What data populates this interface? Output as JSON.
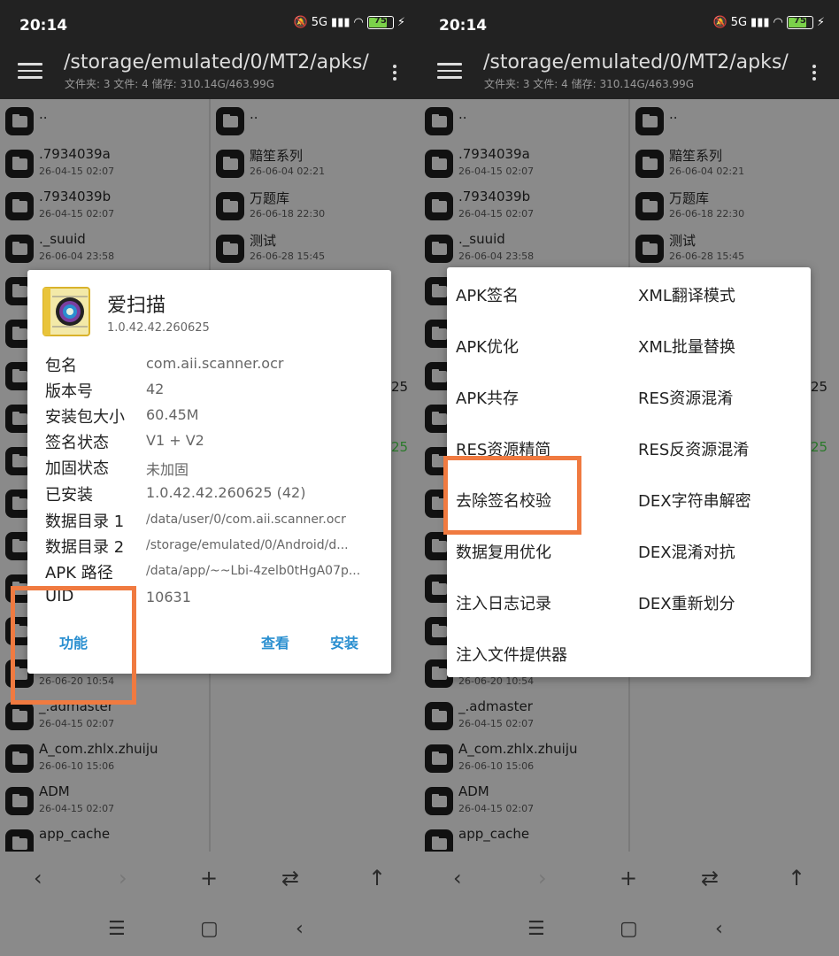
{
  "status": {
    "time": "20:14",
    "signal": "5G",
    "battery": "75"
  },
  "toolbar": {
    "path": "/storage/emulated/0/MT2/apks/",
    "info": "文件夹: 3  文件: 4  储存: 310.14G/463.99G"
  },
  "left_pane": {
    "parent": "..",
    "items": [
      {
        "name": ".7934039a",
        "date": "26-04-15 02:07"
      },
      {
        "name": ".7934039b",
        "date": "26-04-15 02:07"
      },
      {
        "name": "._suuid",
        "date": "26-06-04 23:58"
      }
    ],
    "hidden_item_date": "26-06-20 10:54",
    "bottom_items": [
      {
        "name": "_.admaster",
        "date": "26-04-15 02:07"
      },
      {
        "name": "A_com.zhlx.zhuiju",
        "date": "26-06-10 15:06"
      },
      {
        "name": "ADM",
        "date": "26-04-15 02:07"
      },
      {
        "name": "app_cache",
        "date": ""
      }
    ]
  },
  "right_pane": {
    "parent": "..",
    "items": [
      {
        "name": "黯笙系列",
        "date": "26-06-04 02:21"
      },
      {
        "name": "万题库",
        "date": "26-06-18 22:30"
      },
      {
        "name": "测试",
        "date": "26-06-28 15:45"
      }
    ],
    "frag1": "25",
    "frag2": "25"
  },
  "dialog_info": {
    "app_name": "爱扫描",
    "version": "1.0.42.42.260625",
    "rows": [
      {
        "key": "包名",
        "value": "com.aii.scanner.ocr"
      },
      {
        "key": "版本号",
        "value": "42"
      },
      {
        "key": "安装包大小",
        "value": "60.45M"
      },
      {
        "key": "签名状态",
        "value": "V1 + V2"
      },
      {
        "key": "加固状态",
        "value": "未加固"
      },
      {
        "key": "已安装",
        "value": "1.0.42.42.260625 (42)"
      },
      {
        "key": "数据目录 1",
        "value": "/data/user/0/com.aii.scanner.ocr"
      },
      {
        "key": "数据目录 2",
        "value": "/storage/emulated/0/Android/d..."
      },
      {
        "key": "APK 路径",
        "value": "/data/app/~~Lbi-4zelb0tHgA07p..."
      },
      {
        "key": "UID",
        "value": "10631"
      }
    ],
    "btn_function": "功能",
    "btn_view": "查看",
    "btn_install": "安装"
  },
  "dialog_menu": {
    "left": [
      "APK签名",
      "APK优化",
      "APK共存",
      "RES资源精简",
      "去除签名校验",
      "数据复用优化",
      "注入日志记录",
      "注入文件提供器"
    ],
    "right": [
      "XML翻译模式",
      "XML批量替换",
      "RES资源混淆",
      "RES反资源混淆",
      "DEX字符串解密",
      "DEX混淆对抗",
      "DEX重新划分"
    ]
  },
  "colors": {
    "highlight": "#f07a40",
    "link": "#2a8fd0",
    "bar": "#222222"
  }
}
